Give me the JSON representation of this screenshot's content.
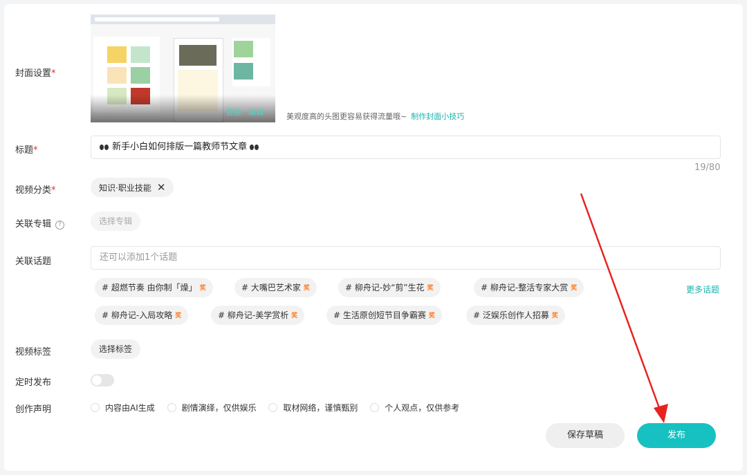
{
  "labels": {
    "cover": "封面设置",
    "title": "标题",
    "category": "视频分类",
    "album": "关联专辑",
    "topics": "关联话题",
    "tags": "视频标签",
    "schedule": "定时发布",
    "declaration": "创作声明"
  },
  "required_mark": "*",
  "help_mark": "?",
  "cover": {
    "hint": "美观度高的头图更容易获得流量哦~",
    "tips_link": "制作封面小技巧",
    "overlay_buttons": [
      "替换",
      "编辑"
    ]
  },
  "title": {
    "value": "新手小白如何排版一篇教师节文章",
    "counter": "19/80"
  },
  "category": {
    "selected": "知识·职业技能",
    "remove_icon": "✕"
  },
  "album": {
    "placeholder": "选择专辑"
  },
  "topics": {
    "placeholder": "还可以添加1个话题",
    "more": "更多话题",
    "hot_badge": "奖",
    "suggestions": [
      "# 超燃节奏 由你制「燥」",
      "# 大嘴巴艺术家",
      "# 柳舟记-妙“剪”生花",
      "# 柳舟记-整活专家大赏",
      "# 柳舟记-入局攻略",
      "# 柳舟记-美学赏析",
      "# 生活原创短节目争霸赛",
      "# 泛娱乐创作人招募"
    ]
  },
  "tags": {
    "button": "选择标签"
  },
  "schedule": {
    "enabled": false
  },
  "declaration": {
    "options": [
      "内容由AI生成",
      "剧情演绎，仅供娱乐",
      "取材网络，谨慎甄别",
      "个人观点，仅供参考"
    ]
  },
  "actions": {
    "save_draft": "保存草稿",
    "publish": "发布"
  },
  "colors": {
    "accent": "#17c1c1",
    "link": "#17b3ad",
    "required": "#f5222d",
    "annotation_arrow": "#e8231f"
  }
}
